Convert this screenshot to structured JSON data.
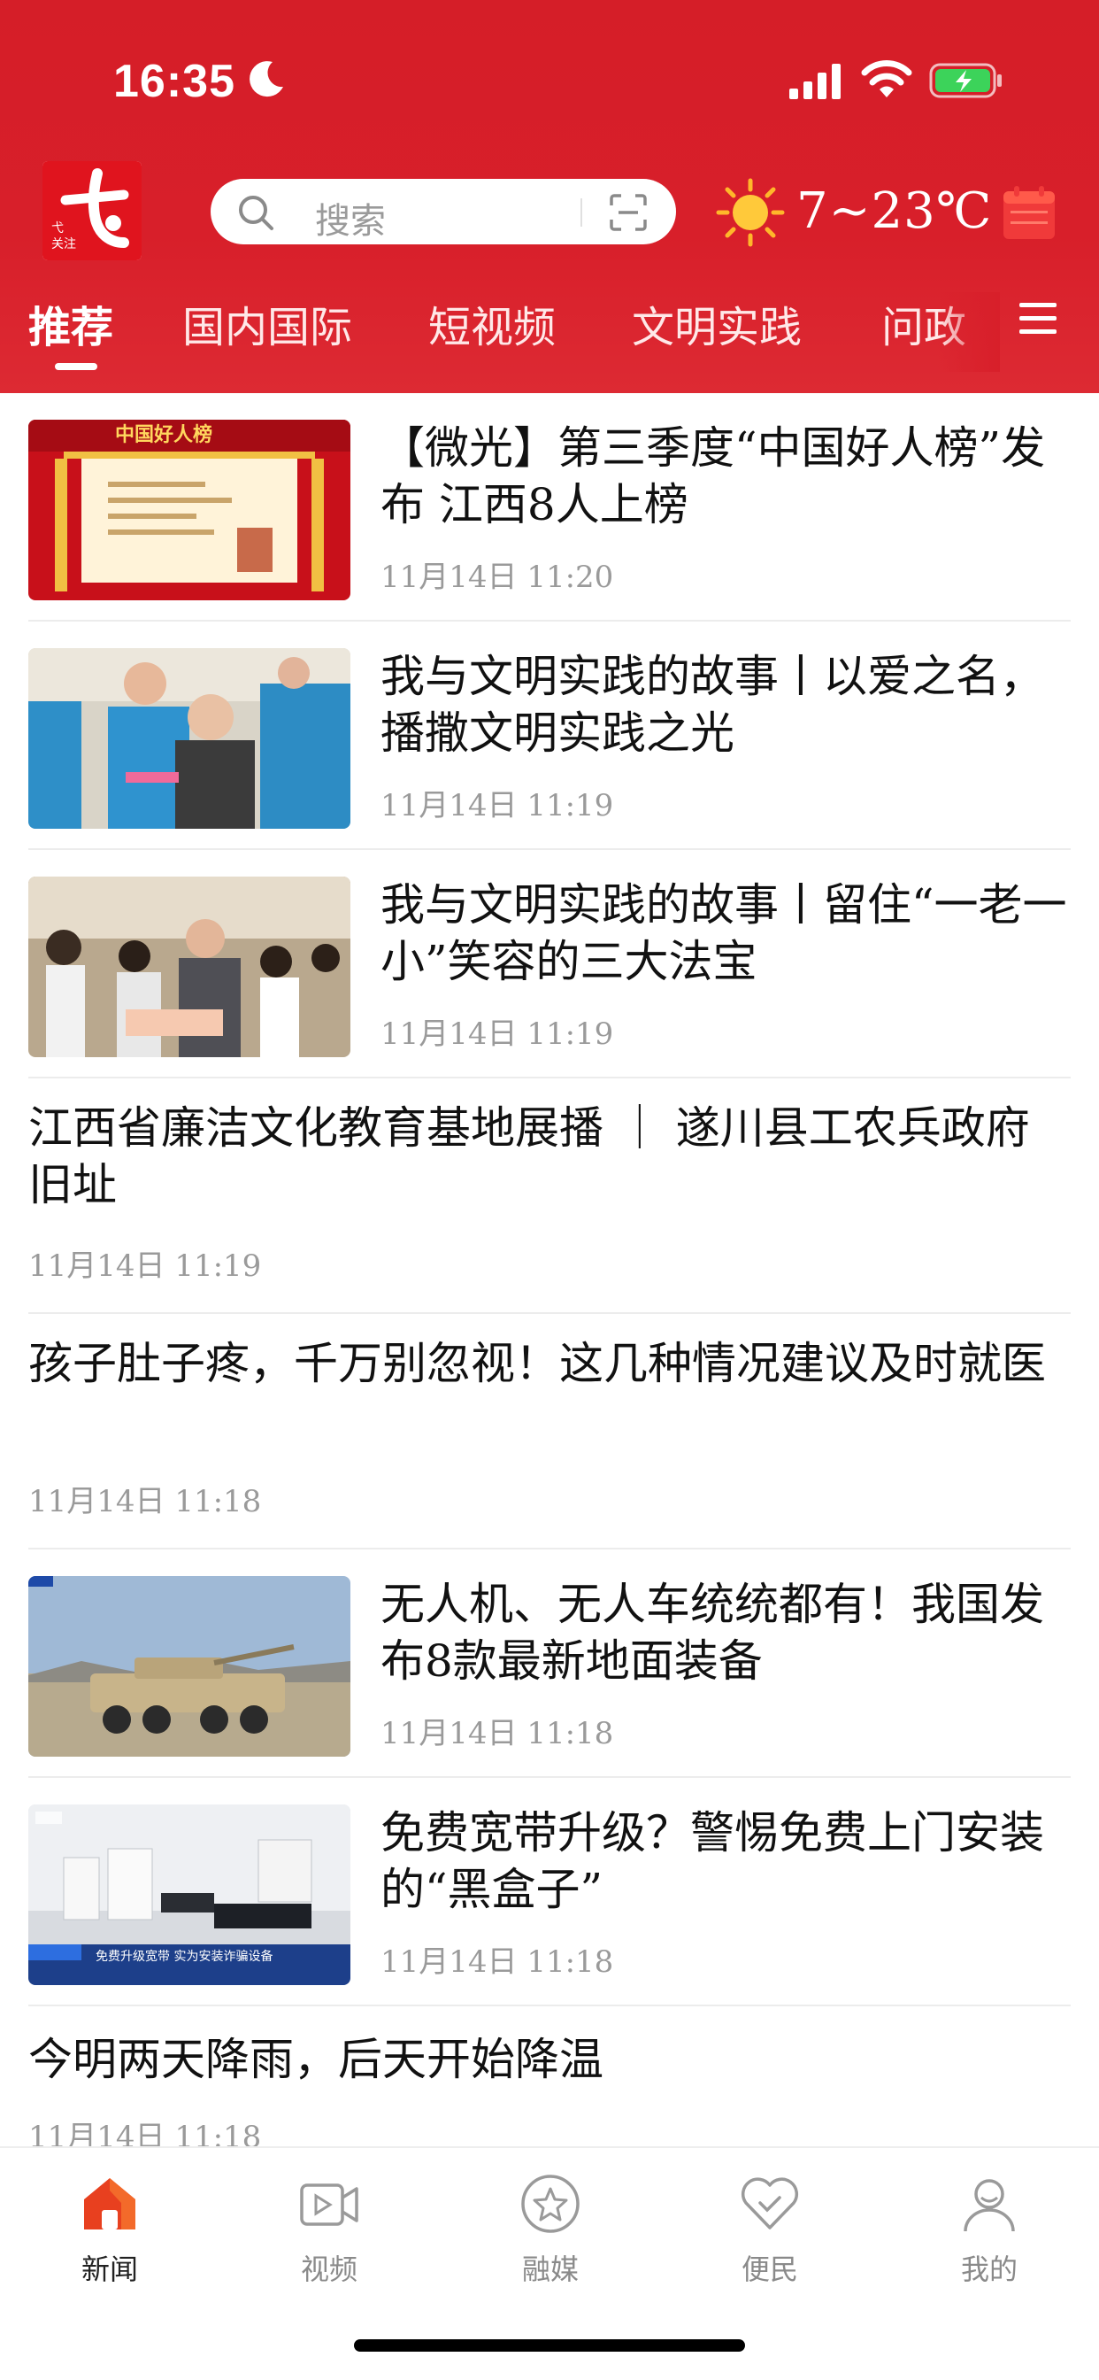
{
  "status_bar": {
    "time": "16:35"
  },
  "header": {
    "logo_name": "yiyang-news-logo",
    "search_placeholder": "搜索",
    "weather": "7~23℃",
    "tabs": [
      {
        "label": "推荐",
        "active": true
      },
      {
        "label": "国内国际",
        "active": false
      },
      {
        "label": "短视频",
        "active": false
      },
      {
        "label": "文明实践",
        "active": false
      },
      {
        "label": "问政",
        "active": false
      }
    ]
  },
  "news": [
    {
      "title": "【微光】第三季度“中国好人榜”发布 江西8人上榜",
      "time": "11月14日 11:20",
      "has_image": true,
      "image": "honor-list-banner"
    },
    {
      "title": "我与文明实践的故事丨以爱之名，播撒文明实践之光",
      "time": "11月14日 11:19",
      "has_image": true,
      "image": "volunteers-photo"
    },
    {
      "title": "我与文明实践的故事丨留住“一老一小”笑容的三大法宝",
      "time": "11月14日 11:19",
      "has_image": true,
      "image": "children-activity-photo"
    },
    {
      "title": "江西省廉洁文化教育基地展播 ｜ 遂川县工农兵政府旧址",
      "time": "11月14日 11:19",
      "has_image": false
    },
    {
      "title": "孩子肚子疼，千万别忽视！这几种情况建议及时就医",
      "time": "11月14日 11:18",
      "has_image": false
    },
    {
      "title": "无人机、无人车统统都有！我国发布8款最新地面装备",
      "time": "11月14日 11:18",
      "has_image": true,
      "image": "armored-vehicle-photo"
    },
    {
      "title": "免费宽带升级？警惕免费上门安装的“黑盒子”",
      "time": "11月14日 11:18",
      "has_image": true,
      "image": "broadband-devices-photo"
    },
    {
      "title": "今明两天降雨，后天开始降温",
      "time": "11月14日 11:18",
      "has_image": false
    }
  ],
  "bottom_nav": [
    {
      "label": "新闻",
      "icon": "home-icon",
      "active": true
    },
    {
      "label": "视频",
      "icon": "video-icon",
      "active": false
    },
    {
      "label": "融媒",
      "icon": "star-circle-icon",
      "active": false
    },
    {
      "label": "便民",
      "icon": "heart-icon",
      "active": false
    },
    {
      "label": "我的",
      "icon": "user-icon",
      "active": false
    }
  ],
  "colors": {
    "brand_red": "#d81f2a",
    "text_gray": "#9a9a9a",
    "active_orange": "#e8401f"
  }
}
